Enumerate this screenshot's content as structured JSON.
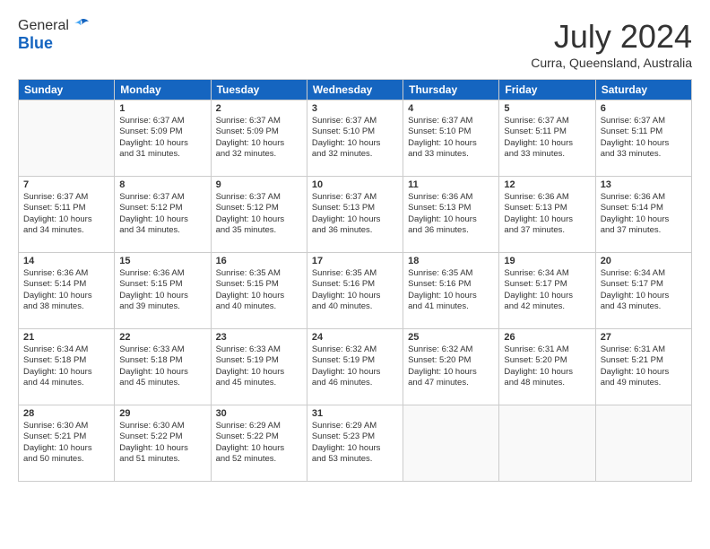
{
  "header": {
    "logo_general": "General",
    "logo_blue": "Blue",
    "month_year": "July 2024",
    "location": "Curra, Queensland, Australia"
  },
  "days_of_week": [
    "Sunday",
    "Monday",
    "Tuesday",
    "Wednesday",
    "Thursday",
    "Friday",
    "Saturday"
  ],
  "weeks": [
    [
      {
        "day": "",
        "info": ""
      },
      {
        "day": "1",
        "info": "Sunrise: 6:37 AM\nSunset: 5:09 PM\nDaylight: 10 hours\nand 31 minutes."
      },
      {
        "day": "2",
        "info": "Sunrise: 6:37 AM\nSunset: 5:09 PM\nDaylight: 10 hours\nand 32 minutes."
      },
      {
        "day": "3",
        "info": "Sunrise: 6:37 AM\nSunset: 5:10 PM\nDaylight: 10 hours\nand 32 minutes."
      },
      {
        "day": "4",
        "info": "Sunrise: 6:37 AM\nSunset: 5:10 PM\nDaylight: 10 hours\nand 33 minutes."
      },
      {
        "day": "5",
        "info": "Sunrise: 6:37 AM\nSunset: 5:11 PM\nDaylight: 10 hours\nand 33 minutes."
      },
      {
        "day": "6",
        "info": "Sunrise: 6:37 AM\nSunset: 5:11 PM\nDaylight: 10 hours\nand 33 minutes."
      }
    ],
    [
      {
        "day": "7",
        "info": "Sunrise: 6:37 AM\nSunset: 5:11 PM\nDaylight: 10 hours\nand 34 minutes."
      },
      {
        "day": "8",
        "info": "Sunrise: 6:37 AM\nSunset: 5:12 PM\nDaylight: 10 hours\nand 34 minutes."
      },
      {
        "day": "9",
        "info": "Sunrise: 6:37 AM\nSunset: 5:12 PM\nDaylight: 10 hours\nand 35 minutes."
      },
      {
        "day": "10",
        "info": "Sunrise: 6:37 AM\nSunset: 5:13 PM\nDaylight: 10 hours\nand 36 minutes."
      },
      {
        "day": "11",
        "info": "Sunrise: 6:36 AM\nSunset: 5:13 PM\nDaylight: 10 hours\nand 36 minutes."
      },
      {
        "day": "12",
        "info": "Sunrise: 6:36 AM\nSunset: 5:13 PM\nDaylight: 10 hours\nand 37 minutes."
      },
      {
        "day": "13",
        "info": "Sunrise: 6:36 AM\nSunset: 5:14 PM\nDaylight: 10 hours\nand 37 minutes."
      }
    ],
    [
      {
        "day": "14",
        "info": "Sunrise: 6:36 AM\nSunset: 5:14 PM\nDaylight: 10 hours\nand 38 minutes."
      },
      {
        "day": "15",
        "info": "Sunrise: 6:36 AM\nSunset: 5:15 PM\nDaylight: 10 hours\nand 39 minutes."
      },
      {
        "day": "16",
        "info": "Sunrise: 6:35 AM\nSunset: 5:15 PM\nDaylight: 10 hours\nand 40 minutes."
      },
      {
        "day": "17",
        "info": "Sunrise: 6:35 AM\nSunset: 5:16 PM\nDaylight: 10 hours\nand 40 minutes."
      },
      {
        "day": "18",
        "info": "Sunrise: 6:35 AM\nSunset: 5:16 PM\nDaylight: 10 hours\nand 41 minutes."
      },
      {
        "day": "19",
        "info": "Sunrise: 6:34 AM\nSunset: 5:17 PM\nDaylight: 10 hours\nand 42 minutes."
      },
      {
        "day": "20",
        "info": "Sunrise: 6:34 AM\nSunset: 5:17 PM\nDaylight: 10 hours\nand 43 minutes."
      }
    ],
    [
      {
        "day": "21",
        "info": "Sunrise: 6:34 AM\nSunset: 5:18 PM\nDaylight: 10 hours\nand 44 minutes."
      },
      {
        "day": "22",
        "info": "Sunrise: 6:33 AM\nSunset: 5:18 PM\nDaylight: 10 hours\nand 45 minutes."
      },
      {
        "day": "23",
        "info": "Sunrise: 6:33 AM\nSunset: 5:19 PM\nDaylight: 10 hours\nand 45 minutes."
      },
      {
        "day": "24",
        "info": "Sunrise: 6:32 AM\nSunset: 5:19 PM\nDaylight: 10 hours\nand 46 minutes."
      },
      {
        "day": "25",
        "info": "Sunrise: 6:32 AM\nSunset: 5:20 PM\nDaylight: 10 hours\nand 47 minutes."
      },
      {
        "day": "26",
        "info": "Sunrise: 6:31 AM\nSunset: 5:20 PM\nDaylight: 10 hours\nand 48 minutes."
      },
      {
        "day": "27",
        "info": "Sunrise: 6:31 AM\nSunset: 5:21 PM\nDaylight: 10 hours\nand 49 minutes."
      }
    ],
    [
      {
        "day": "28",
        "info": "Sunrise: 6:30 AM\nSunset: 5:21 PM\nDaylight: 10 hours\nand 50 minutes."
      },
      {
        "day": "29",
        "info": "Sunrise: 6:30 AM\nSunset: 5:22 PM\nDaylight: 10 hours\nand 51 minutes."
      },
      {
        "day": "30",
        "info": "Sunrise: 6:29 AM\nSunset: 5:22 PM\nDaylight: 10 hours\nand 52 minutes."
      },
      {
        "day": "31",
        "info": "Sunrise: 6:29 AM\nSunset: 5:23 PM\nDaylight: 10 hours\nand 53 minutes."
      },
      {
        "day": "",
        "info": ""
      },
      {
        "day": "",
        "info": ""
      },
      {
        "day": "",
        "info": ""
      }
    ]
  ]
}
